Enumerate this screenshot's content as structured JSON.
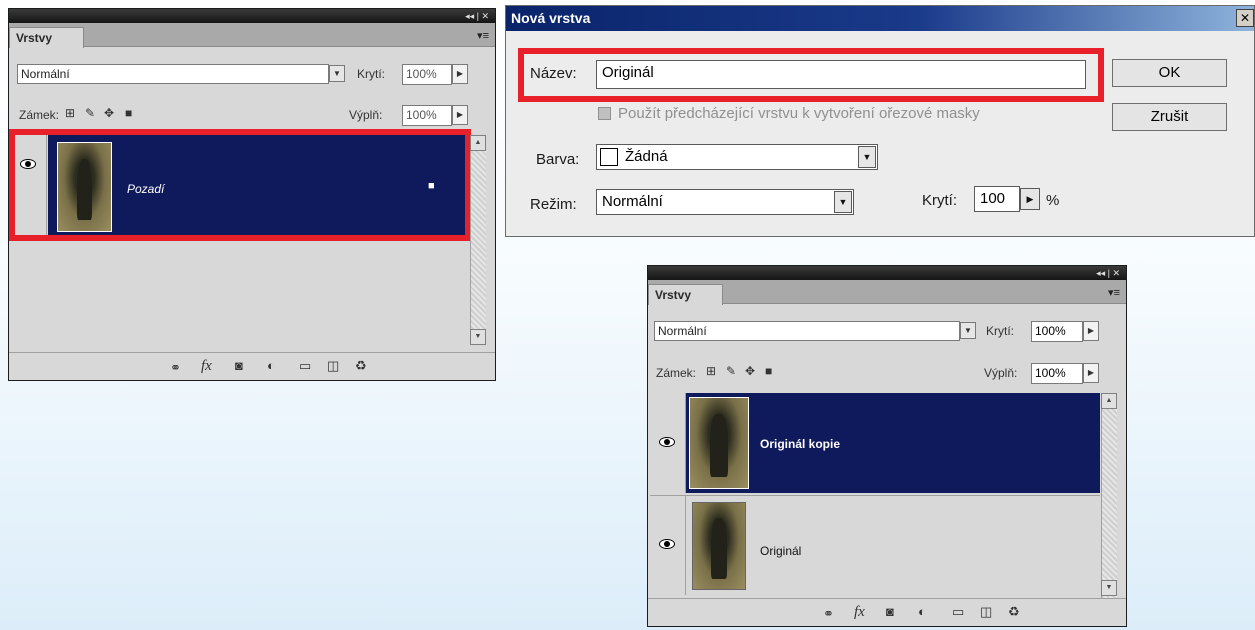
{
  "panel1": {
    "title_controls": "◂◂ | ✕",
    "tab": "Vrstvy",
    "menu_icon": "▾≡",
    "blend_mode": "Normální",
    "opacity_label": "Krytí:",
    "opacity_value": "100%",
    "lock_label": "Zámek:",
    "fill_label": "Výplň:",
    "fill_value": "100%",
    "layers": [
      {
        "name": "Pozadí",
        "selected": true,
        "locked": true
      }
    ]
  },
  "dialog": {
    "title": "Nová vrstva",
    "name_label": "Název:",
    "name_value": "Originál",
    "ok_label": "OK",
    "cancel_label": "Zrušit",
    "clip_label": "Použít předcházející vrstvu k vytvoření ořezové masky",
    "color_label": "Barva:",
    "color_value": "Žádná",
    "mode_label": "Režim:",
    "mode_value": "Normální",
    "opacity_label": "Krytí:",
    "opacity_value": "100",
    "percent": "%"
  },
  "panel2": {
    "title_controls": "◂◂ | ✕",
    "tab": "Vrstvy",
    "menu_icon": "▾≡",
    "blend_mode": "Normální",
    "opacity_label": "Krytí:",
    "opacity_value": "100%",
    "lock_label": "Zámek:",
    "fill_label": "Výplň:",
    "fill_value": "100%",
    "layers": [
      {
        "name": "Originál kopie",
        "selected": true
      },
      {
        "name": "Originál",
        "selected": false
      }
    ]
  },
  "colors": {
    "selection": "#0f1a5c",
    "highlight": "#e8202a",
    "dialog_title": "#0a246a"
  }
}
